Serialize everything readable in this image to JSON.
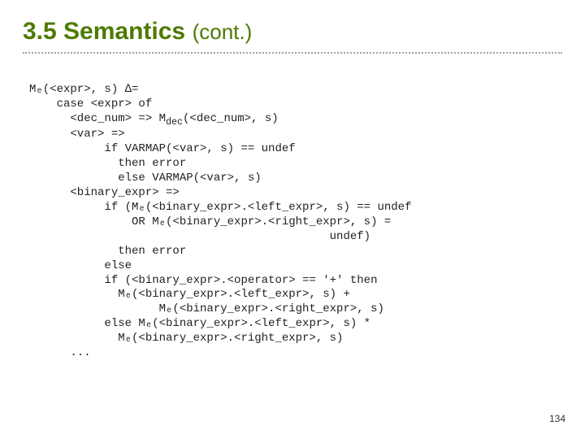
{
  "title": {
    "main": "3.5 Semantics",
    "sub": "(cont.)"
  },
  "code": {
    "l01": "Mₑ(<expr>, s) ∆=",
    "l02": "    case <expr> of",
    "l03": "      <dec_num> => M",
    "l03b": "(<dec_num>, s)",
    "l03sub": "dec",
    "l04": "      <var> =>",
    "l05": "           if VARMAP(<var>, s) == undef",
    "l06": "             then error",
    "l07": "             else VARMAP(<var>, s)",
    "l08": "      <binary_expr> =>",
    "l09": "           if (Mₑ(<binary_expr>.<left_expr>, s) == undef",
    "l10": "               OR Mₑ(<binary_expr>.<right_expr>, s) =",
    "l11": "                                            undef)",
    "l12": "             then error",
    "l13": "           else",
    "l14": "           if (<binary_expr>.<operator> == '+' then",
    "l15": "             Mₑ(<binary_expr>.<left_expr>, s) +",
    "l16": "                   Mₑ(<binary_expr>.<right_expr>, s)",
    "l17": "           else Mₑ(<binary_expr>.<left_expr>, s) *",
    "l18": "             Mₑ(<binary_expr>.<right_expr>, s)",
    "l19": "      ..."
  },
  "page_number": "134"
}
